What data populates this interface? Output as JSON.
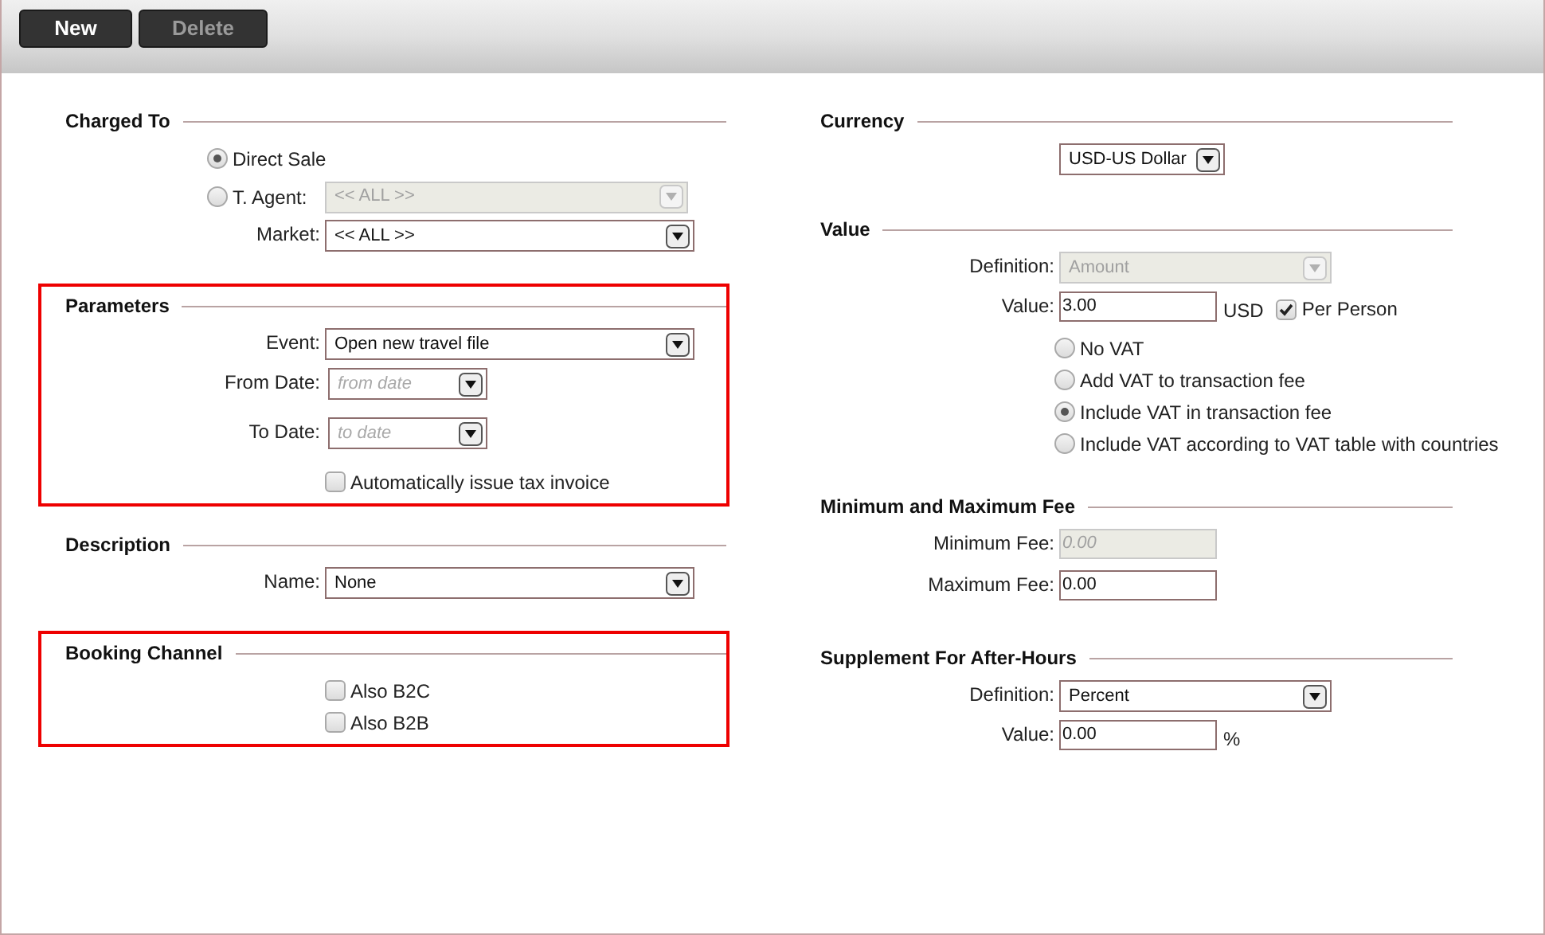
{
  "toolbar": {
    "buttons": [
      {
        "label": "New",
        "disabled": false
      },
      {
        "label": "Delete",
        "disabled": true
      }
    ]
  },
  "columns": [
    {
      "sections": [
        {
          "title": "Charged To",
          "highlighted": false,
          "rows": [
            {
              "kind": "radio",
              "label": "Direct Sale",
              "selected": true
            },
            {
              "kind": "radio",
              "label": "T. Agent:",
              "selected": false,
              "select": {
                "value": "<< ALL >>",
                "disabled": true
              }
            },
            {
              "kind": "select",
              "label": "Market:",
              "value": "<< ALL >>",
              "disabled": false
            }
          ]
        },
        {
          "title": "Parameters",
          "highlighted": true,
          "rows": [
            {
              "kind": "select",
              "label": "Event:",
              "value": "Open new travel file",
              "disabled": false
            },
            {
              "kind": "date",
              "label": "From Date:",
              "placeholder": "from date"
            },
            {
              "kind": "date",
              "label": "To Date:",
              "placeholder": "to date"
            },
            {
              "kind": "checkbox",
              "label": "Automatically issue tax invoice",
              "checked": false
            }
          ]
        },
        {
          "title": "Description",
          "highlighted": false,
          "rows": [
            {
              "kind": "select",
              "label": "Name:",
              "value": "None",
              "disabled": false
            }
          ]
        },
        {
          "title": "Booking Channel",
          "highlighted": true,
          "rows": [
            {
              "kind": "checkbox",
              "label": "Also B2C",
              "checked": false
            },
            {
              "kind": "checkbox",
              "label": "Also B2B",
              "checked": false
            }
          ]
        }
      ]
    },
    {
      "sections": [
        {
          "title": "Currency",
          "highlighted": false,
          "rows": [
            {
              "kind": "select",
              "value": "USD-US Dollar",
              "disabled": false
            }
          ]
        },
        {
          "title": "Value",
          "highlighted": false,
          "rows": [
            {
              "kind": "select",
              "label": "Definition:",
              "value": "Amount",
              "disabled": true
            },
            {
              "kind": "text",
              "label": "Value:",
              "value": "3.00",
              "disabled": false,
              "unit": "USD",
              "checkbox": {
                "label": "Per Person",
                "checked": true
              }
            },
            {
              "kind": "radio",
              "label": "No VAT",
              "selected": false
            },
            {
              "kind": "radio",
              "label": "Add VAT to transaction fee",
              "selected": false
            },
            {
              "kind": "radio",
              "label": "Include VAT in transaction fee",
              "selected": true
            },
            {
              "kind": "radio",
              "label": "Include VAT according to VAT table with countries",
              "selected": false
            }
          ]
        },
        {
          "title": "Minimum and Maximum Fee",
          "highlighted": false,
          "rows": [
            {
              "kind": "text",
              "label": "Minimum Fee:",
              "placeholder": "0.00",
              "disabled": true
            },
            {
              "kind": "text",
              "label": "Maximum Fee:",
              "value": "0.00",
              "disabled": false
            }
          ]
        },
        {
          "title": "Supplement For After-Hours",
          "highlighted": false,
          "rows": [
            {
              "kind": "select",
              "label": "Definition:",
              "value": "Percent",
              "disabled": false
            },
            {
              "kind": "text",
              "label": "Value:",
              "value": "0.00",
              "disabled": false,
              "unit": "%"
            }
          ]
        }
      ]
    }
  ]
}
